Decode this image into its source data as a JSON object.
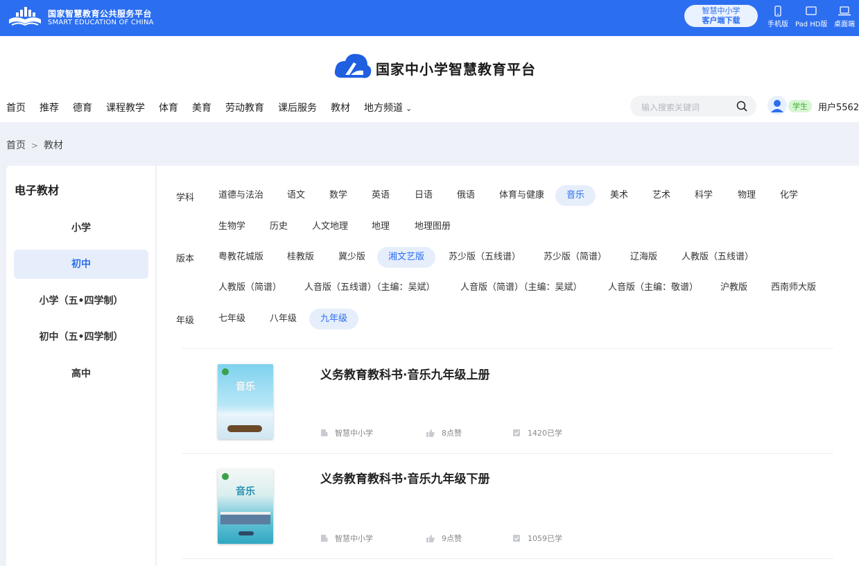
{
  "topbar": {
    "logo_cn": "国家智慧教育公共服务平台",
    "logo_en": "SMART EDUCATION OF CHINA",
    "download_line1": "智慧中小学",
    "download_line2": "客户端下载",
    "devices": [
      {
        "label": "手机版",
        "icon": "phone-icon"
      },
      {
        "label": "Pad HD版",
        "icon": "tablet-icon"
      },
      {
        "label": "桌面端",
        "icon": "laptop-icon"
      }
    ]
  },
  "header": {
    "brand": "国家中小学智慧教育平台",
    "nav": [
      "首页",
      "推荐",
      "德育",
      "课程教学",
      "体育",
      "美育",
      "劳动教育",
      "课后服务",
      "教材",
      "地方频道"
    ],
    "search_placeholder": "输入搜索关键词",
    "user_badge": "学生",
    "username": "用户5562"
  },
  "breadcrumb": {
    "home": "首页",
    "sep": ">",
    "current": "教材"
  },
  "sidebar": {
    "title": "电子教材",
    "items": [
      "小学",
      "初中",
      "小学（五•四学制）",
      "初中（五•四学制）",
      "高中"
    ],
    "active_index": 1
  },
  "filters": {
    "subject_label": "学科",
    "subjects": [
      "道德与法治",
      "语文",
      "数学",
      "英语",
      "日语",
      "俄语",
      "体育与健康",
      "音乐",
      "美术",
      "艺术",
      "科学",
      "物理",
      "化学",
      "生物学",
      "历史",
      "人文地理",
      "地理",
      "地理图册"
    ],
    "subject_active": "音乐",
    "edition_label": "版本",
    "editions": [
      "粤教花城版",
      "桂教版",
      "冀少版",
      "湘文艺版",
      "苏少版（五线谱）",
      "苏少版（简谱）",
      "辽海版",
      "人教版（五线谱）",
      "人教版（简谱）",
      "人音版（五线谱）（主编：吴斌）",
      "人音版（简谱）（主编：吴斌）",
      "人音版（主编：敬谱）",
      "沪教版",
      "西南师大版"
    ],
    "edition_active": "湘文艺版",
    "grade_label": "年级",
    "grades": [
      "七年级",
      "八年级",
      "九年级"
    ],
    "grade_active": "九年级"
  },
  "books": [
    {
      "title": "义务教育教科书·音乐九年级上册",
      "cover_text": "音乐",
      "publisher": "智慧中小学",
      "likes": "8点赞",
      "learned": "1420已学"
    },
    {
      "title": "义务教育教科书·音乐九年级下册",
      "cover_text": "音乐",
      "publisher": "智慧中小学",
      "likes": "9点赞",
      "learned": "1059已学"
    }
  ],
  "colors": {
    "primary": "#2b6ef0",
    "active_bg": "#e6eefc",
    "badge_green": "#3eae35"
  }
}
